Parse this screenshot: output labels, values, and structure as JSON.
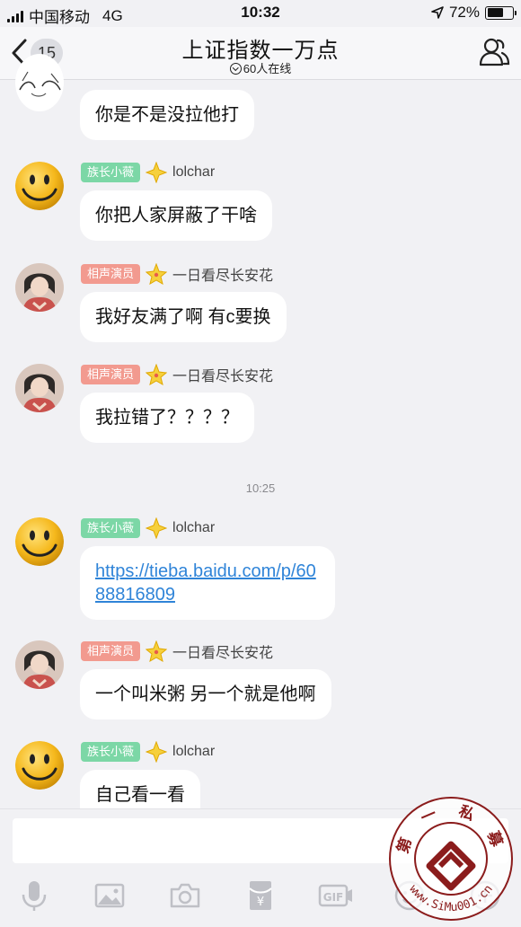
{
  "status": {
    "carrier": "中国移动",
    "network": "4G",
    "time": "10:32",
    "battery": "72%",
    "battery_level": 0.72
  },
  "header": {
    "unread_count": "15",
    "title": "上证指数一万点",
    "online": "60人在线"
  },
  "timestamp": "10:25",
  "messages": [
    {
      "tag": "",
      "nick": "",
      "text": "你是不是没拉他打",
      "avatar": "anime-girl-avatar"
    },
    {
      "tag": "族长小薇",
      "nick": "lolchar",
      "text": "你把人家屏蔽了干啥",
      "avatar": "smiley-avatar"
    },
    {
      "tag": "相声演员",
      "nick": "一日看尽长安花",
      "text": "我好友满了啊 有c要换",
      "avatar": "girl-avatar"
    },
    {
      "tag": "相声演员",
      "nick": "一日看尽长安花",
      "text": "我拉错了？？？？",
      "avatar": "girl-avatar"
    },
    {
      "tag": "族长小薇",
      "nick": "lolchar",
      "text": "https://tieba.baidu.com/p/6088816809",
      "avatar": "smiley-avatar"
    },
    {
      "tag": "相声演员",
      "nick": "一日看尽长安花",
      "text": "一个叫米粥 另一个就是他啊",
      "avatar": "girl-avatar"
    },
    {
      "tag": "族长小薇",
      "nick": "lolchar",
      "text": "自己看一看",
      "avatar": "smiley-avatar"
    }
  ],
  "toolbar": [
    "microphone-icon",
    "image-icon",
    "camera-icon",
    "red-packet-icon",
    "gif-icon",
    "emoji-icon",
    "plus-icon"
  ],
  "watermark": {
    "top_text": "第 一 私 募",
    "bottom_text": "www.SiMu001.cn"
  },
  "colors": {
    "tag_green": "#7cd7a6",
    "tag_red": "#f29a8f",
    "link": "#2f84d8"
  }
}
